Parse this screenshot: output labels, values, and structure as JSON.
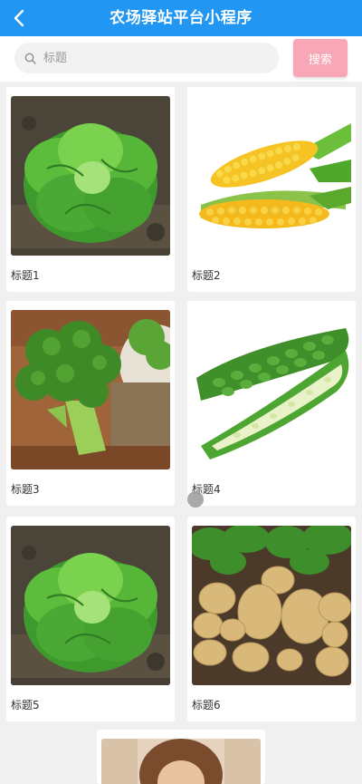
{
  "header": {
    "title": "农场驿站平台小程序",
    "back_icon": "chevron-left-icon",
    "background": "#2196f3"
  },
  "search": {
    "placeholder": "标题",
    "button_label": "搜索",
    "icon": "search-icon",
    "button_color": "#f7a7b5"
  },
  "products": [
    {
      "title": "标题1",
      "image": "lettuce"
    },
    {
      "title": "标题2",
      "image": "corn"
    },
    {
      "title": "标题3",
      "image": "broccoli"
    },
    {
      "title": "标题4",
      "image": "bitter-melon"
    },
    {
      "title": "标题5",
      "image": "lettuce"
    },
    {
      "title": "标题6",
      "image": "potatoes"
    },
    {
      "title": "",
      "image": "portrait-partial"
    }
  ]
}
